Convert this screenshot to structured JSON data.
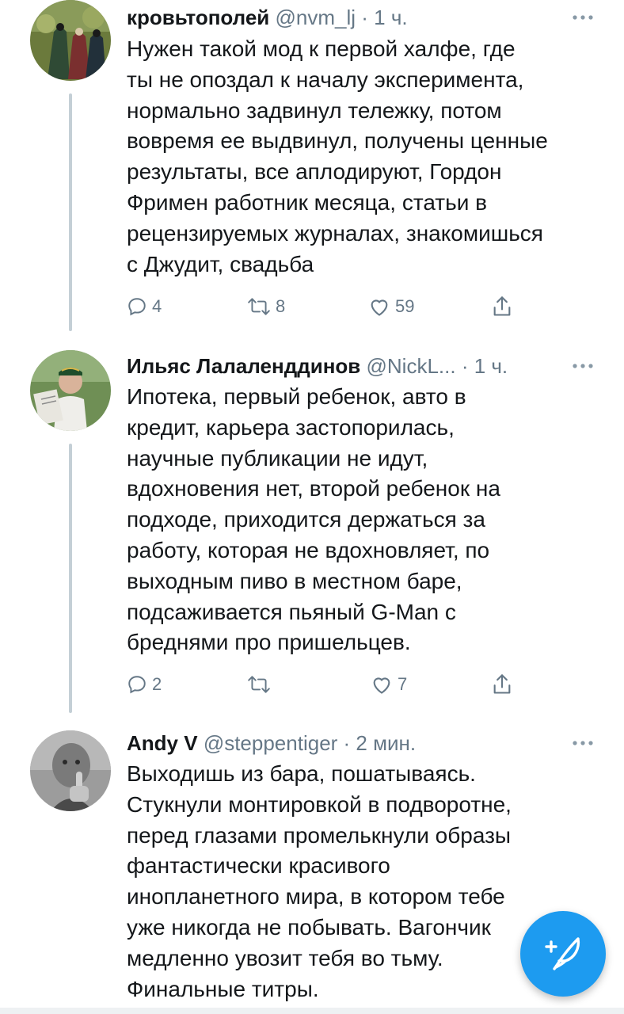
{
  "tweets": [
    {
      "name": "кровьтополей",
      "handle": "@nvm_lj",
      "dot": " · ",
      "time": "1 ч.",
      "text": "Нужен такой мод к первой халфе, где\nты не опоздал к началу эксперимента,\nнормально задвинул тележку, потом\nвовремя ее выдвинул, получены ценные\nрезультаты, все аплодируют, Гордон\nФримен работник месяца, статьи в\nрецензируемых журналах, знакомишься\nс Джудит, свадьба",
      "replies": "4",
      "retweets": "8",
      "likes": "59"
    },
    {
      "name": "Ильяс Лалаленддинов",
      "handle": "@NickL...",
      "dot": " · ",
      "time": "1 ч.",
      "text": "Ипотека, первый ребенок, авто в\nкредит, карьера застопорилась,\nнаучные публикации не идут,\nвдохновения нет, второй ребенок на\nподходе, приходится держаться за\nработу, которая не вдохновляет, по\nвыходным пиво в местном баре,\nподсаживается пьяный G-Man с\nбреднями про пришельцев.",
      "replies": "2",
      "retweets": "",
      "likes": "7"
    },
    {
      "name": "Andy V",
      "handle": "@steppentiger",
      "dot": " · ",
      "time": "2 мин.",
      "text": "Выходишь из бара, пошатываясь.\nСтукнули монтировкой в подворотне,\nперед глазами промелькнули образы\nфантастически красивого\nинопланетного мира, в котором тебе\nуже никогда не побывать. Вагончик\nмедленно увозит тебя во тьму.\nФинальные титры."
    }
  ],
  "icons": {
    "more": "more-icon",
    "reply": "reply-icon",
    "retweet": "retweet-icon",
    "like": "heart-icon",
    "share": "share-icon",
    "compose": "compose-tweet-icon"
  },
  "colors": {
    "accent": "#1d9bf0",
    "text": "#14171a",
    "muted": "#657786",
    "thread_line": "#c4cfd6"
  }
}
